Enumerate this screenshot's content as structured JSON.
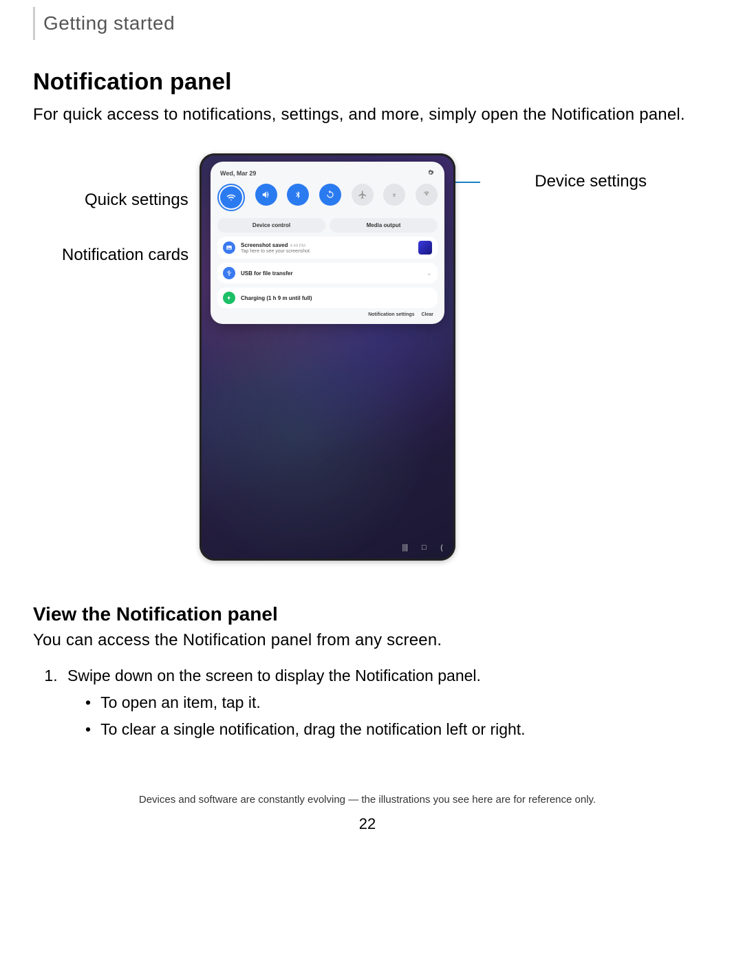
{
  "breadcrumb": "Getting started",
  "title": "Notification panel",
  "intro": "For quick access to notifications, settings, and more, simply open the Notification panel.",
  "callouts": {
    "quick_settings": "Quick settings",
    "notification_cards": "Notification cards",
    "device_settings": "Device settings"
  },
  "device": {
    "date": "Wed, Mar 29",
    "qs_icons": [
      "wifi",
      "sound",
      "bluetooth",
      "rotate",
      "airplane",
      "download",
      "hotspot"
    ],
    "qs_active": [
      true,
      true,
      true,
      true,
      false,
      false,
      false
    ],
    "wide_buttons": [
      "Device control",
      "Media output"
    ],
    "notifications": [
      {
        "icon": "image",
        "color": "blue",
        "title": "Screenshot saved",
        "time": "4:49 PM",
        "sub": "Tap here to see your screenshot.",
        "thumb": true
      },
      {
        "icon": "usb",
        "color": "blue",
        "title": "USB for file transfer",
        "sub": "",
        "chev": true
      },
      {
        "icon": "charge",
        "color": "green",
        "title": "Charging (1 h 9 m until full)",
        "sub": ""
      }
    ],
    "footer_links": [
      "Notification settings",
      "Clear"
    ]
  },
  "subheading": "View the Notification panel",
  "sub_intro": "You can access the Notification panel from any screen.",
  "steps": [
    "Swipe down on the screen to display the Notification panel."
  ],
  "bullets": [
    "To open an item, tap it.",
    "To clear a single notification, drag the notification left or right."
  ],
  "footnote": "Devices and software are constantly evolving — the illustrations you see here are for reference only.",
  "page_number": "22"
}
